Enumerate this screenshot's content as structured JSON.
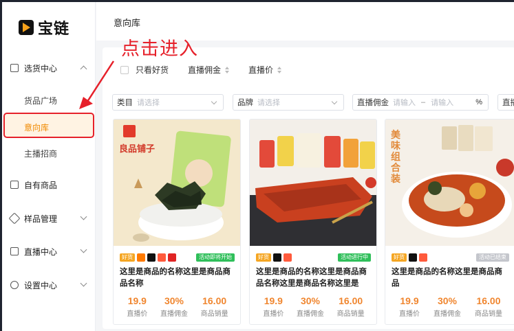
{
  "app": {
    "logo_text": "宝链"
  },
  "sidebar": {
    "groups": [
      {
        "label": "选货中心",
        "icon": "download-tray-icon",
        "expanded": true,
        "children": [
          {
            "label": "货品广场"
          },
          {
            "label": "意向库",
            "active": true
          },
          {
            "label": "主播招商"
          }
        ]
      },
      {
        "label": "自有商品",
        "icon": "bag-icon"
      },
      {
        "label": "样品管理",
        "icon": "cube-icon"
      },
      {
        "label": "直播中心",
        "icon": "live-icon"
      },
      {
        "label": "设置中心",
        "icon": "gear-icon"
      }
    ]
  },
  "page": {
    "title": "意向库"
  },
  "annotation": {
    "text": "点击进入",
    "color": "#e6202a"
  },
  "filters": {
    "only_good": "只看好货",
    "sort_commission": "直播佣金",
    "sort_price": "直播价",
    "category": {
      "label": "类目",
      "placeholder": "请选择"
    },
    "brand": {
      "label": "品牌",
      "placeholder": "请选择"
    },
    "commission": {
      "label": "直播佣金",
      "from_placeholder": "请输入",
      "dash": "–",
      "to_placeholder": "请输入",
      "unit": "%"
    },
    "extra": {
      "label": "直播"
    }
  },
  "products": [
    {
      "name": "这里是商品的名称这里是商品商品名称",
      "good_tag": "好货",
      "status": "活动即将开始",
      "status_color": "#2fbf5a",
      "price": "19.9",
      "price_label": "直播价",
      "commission": "30%",
      "commission_label": "直播佣金",
      "sales": "16.00",
      "sales_label": "商品销量",
      "platforms": [
        "taobao-icon",
        "douyin-icon",
        "kuaishou-icon",
        "tmall-icon"
      ],
      "image_logo": "良品铺子"
    },
    {
      "name": "这里是商品的名称这里是商品商品名称这里是商品名称这里是",
      "good_tag": "好货",
      "status": "活动进行中",
      "status_color": "#2fbf5a",
      "price": "19.9",
      "price_label": "直播价",
      "commission": "30%",
      "commission_label": "直播佣金",
      "sales": "16.00",
      "sales_label": "商品销量",
      "platforms": [
        "douyin-icon",
        "kuaishou-icon"
      ]
    },
    {
      "name": "这里是商品的名称这里是商品商品",
      "good_tag": "好货",
      "status": "活动已结束",
      "status_color": "#c4c6cc",
      "price": "19.9",
      "price_label": "直播价",
      "commission": "30%",
      "commission_label": "直播佣金",
      "sales": "16.00",
      "sales_label": "商品销量",
      "platforms": [
        "douyin-icon",
        "kuaishou-icon"
      ],
      "image_slogan": "美味组合装"
    }
  ],
  "colors": {
    "accent": "#f08a00",
    "price": "#f0862f",
    "annotation": "#e6202a"
  }
}
